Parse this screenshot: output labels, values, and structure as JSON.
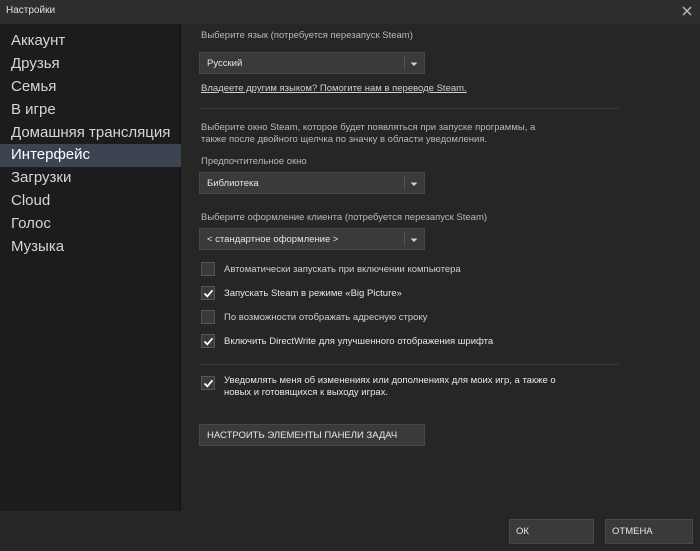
{
  "window": {
    "title": "Настройки"
  },
  "sidebar": {
    "items": [
      {
        "label": "Аккаунт"
      },
      {
        "label": "Друзья"
      },
      {
        "label": "Семья"
      },
      {
        "label": "В игре"
      },
      {
        "label": "Домашняя трансляция"
      },
      {
        "label": "Интерфейс",
        "active": true
      },
      {
        "label": "Загрузки"
      },
      {
        "label": "Cloud"
      },
      {
        "label": "Голос"
      },
      {
        "label": "Музыка"
      }
    ]
  },
  "content": {
    "language": {
      "label": "Выберите язык (потребуется перезапуск Steam)",
      "value": "Русский",
      "help_link": "Владеете другим языком? Помогите нам в переводе Steam."
    },
    "startup_window": {
      "description_line1": "Выберите окно Steam, которое будет появляться при запуске программы, а",
      "description_line2": "также после двойного щелчка по значку в области уведомления.",
      "label": "Предпочтительное окно",
      "value": "Библиотека"
    },
    "skin": {
      "label": "Выберите оформление клиента (потребуется перезапуск Steam)",
      "value": "< стандартное оформление >"
    },
    "checkboxes": [
      {
        "label": "Автоматически запускать при включении компьютера",
        "checked": false
      },
      {
        "label": "Запускать Steam в режиме «Big Picture»",
        "checked": true
      },
      {
        "label": "По возможности отображать адресную строку",
        "checked": false
      },
      {
        "label": "Включить DirectWrite для улучшенного отображения шрифта",
        "checked": true
      }
    ],
    "notify": {
      "line1": "Уведомлять меня об изменениях или дополнениях для моих игр, а также о",
      "line2": "новых и готовящихся к выходу играх.",
      "checked": true
    },
    "taskbar_button": "НАСТРОИТЬ ЭЛЕМЕНТЫ ПАНЕЛИ ЗАДАЧ"
  },
  "footer": {
    "ok": "ОК",
    "cancel": "ОТМЕНА"
  }
}
